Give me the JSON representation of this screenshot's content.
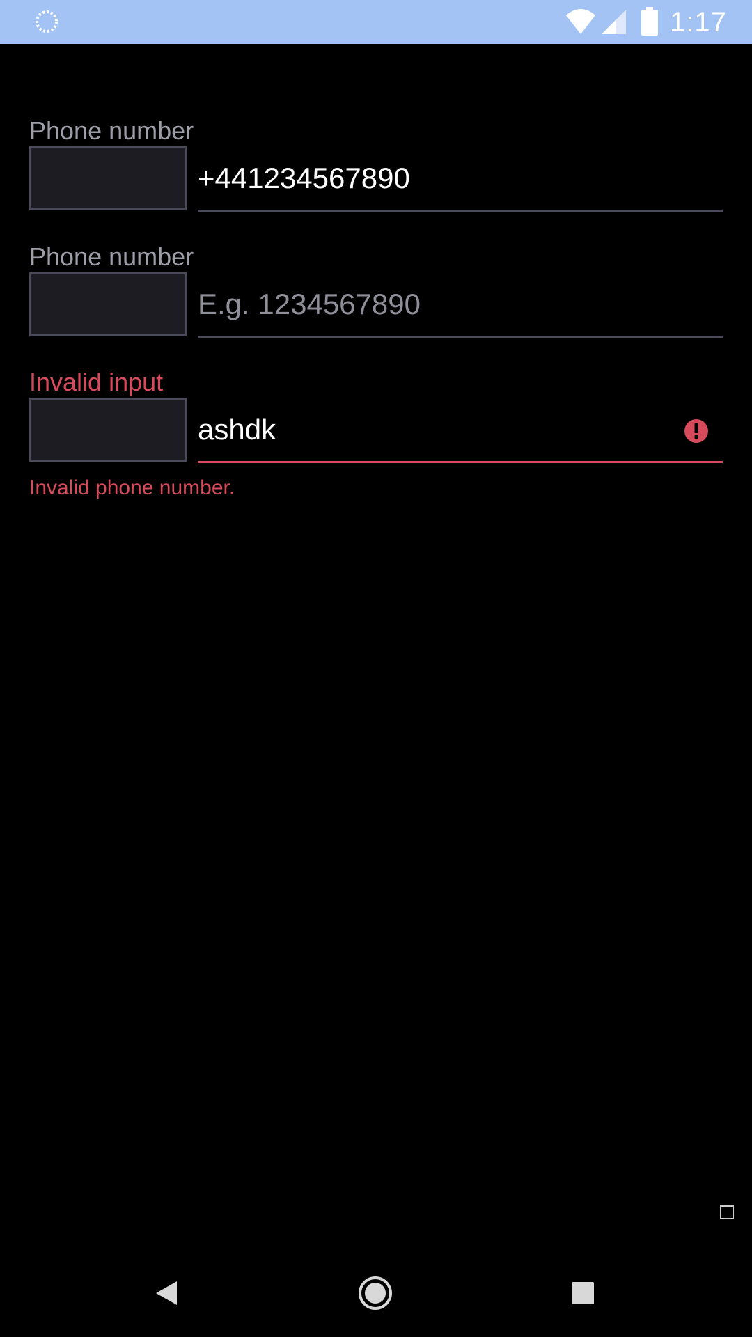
{
  "status_bar": {
    "time": "1:17",
    "background": "#a3c3f5",
    "icons": [
      "loading-spinner-icon",
      "wifi-icon",
      "cell-signal-icon",
      "battery-icon"
    ]
  },
  "fields": [
    {
      "label": "Phone number",
      "value": "+441234567890",
      "placeholder": "",
      "state": "filled"
    },
    {
      "label": "Phone number",
      "value": "",
      "placeholder": "E.g. 1234567890",
      "state": "empty"
    },
    {
      "label": "Invalid input",
      "value": "ashdk",
      "placeholder": "",
      "state": "error",
      "helper": "Invalid phone number."
    }
  ],
  "colors": {
    "background": "#000000",
    "label": "#9e9ea8",
    "error": "#d64a5c",
    "box_fill": "#1d1c22",
    "border": "#4a4a5a"
  },
  "nav_bar": {
    "icons": [
      "back-icon",
      "home-icon",
      "recents-icon"
    ]
  }
}
